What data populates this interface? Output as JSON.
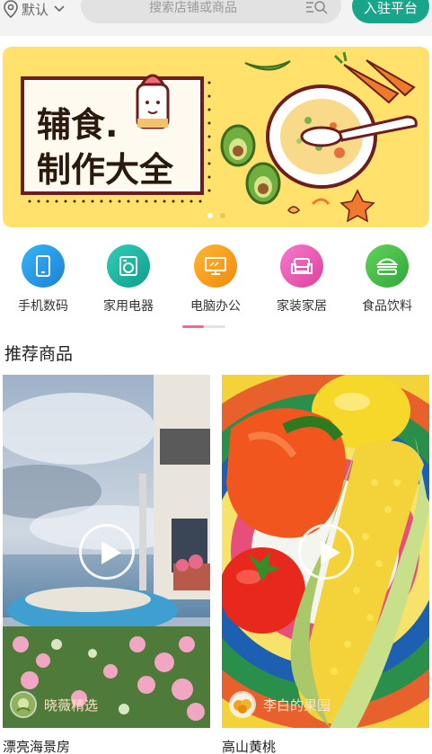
{
  "header": {
    "location": "默认",
    "search_placeholder": "搜索店铺或商品",
    "join_label": "入驻平台"
  },
  "banner": {
    "line1": "辅食.",
    "line2": "制作大全",
    "dots": 2,
    "active_dot": 0
  },
  "categories": [
    {
      "label": "手机数码",
      "icon": "phone-icon",
      "color": "#2aa3e6"
    },
    {
      "label": "家用电器",
      "icon": "washing-machine-icon",
      "color": "#1db8a5"
    },
    {
      "label": "电脑办公",
      "icon": "monitor-icon",
      "color": "#f7a11b"
    },
    {
      "label": "家装家居",
      "icon": "sofa-icon",
      "color": "#ef5fb5"
    },
    {
      "label": "食品饮料",
      "icon": "burger-icon",
      "color": "#4bc24b"
    }
  ],
  "section_title": "推荐商品",
  "products": [
    {
      "shop": "晓薇精选",
      "title": "漂亮海景房"
    },
    {
      "shop": "李白的果园",
      "title": "高山黄桃"
    }
  ]
}
